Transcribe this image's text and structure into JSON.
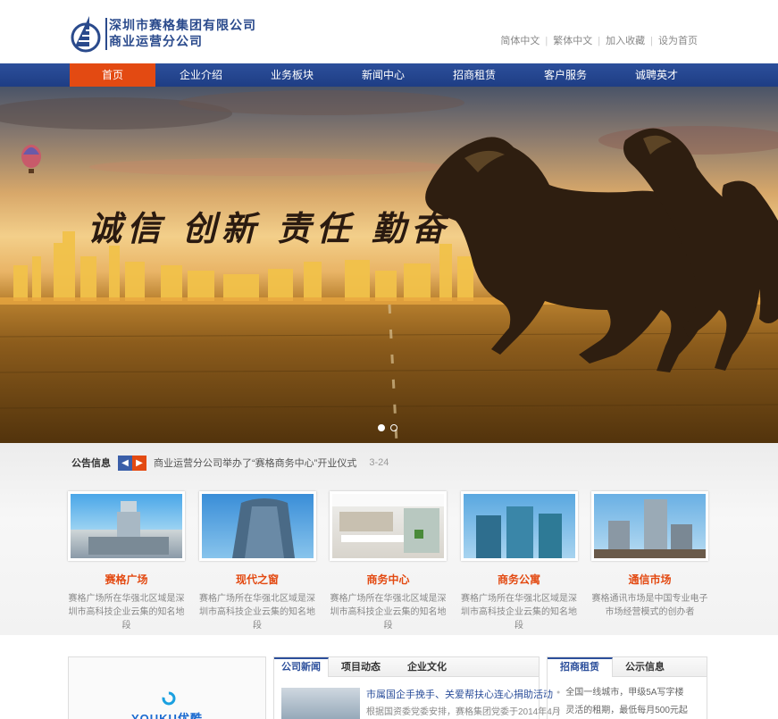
{
  "header": {
    "logo_line1": "深圳市赛格集团有限公司",
    "logo_line2": "商业运营分公司",
    "top_links": [
      "简体中文",
      "繁体中文",
      "加入收藏",
      "设为首页"
    ]
  },
  "nav": {
    "items": [
      "首页",
      "企业介绍",
      "业务板块",
      "新闻中心",
      "招商租赁",
      "客户服务",
      "诚聘英才"
    ],
    "active_index": 0
  },
  "banner": {
    "slogan": [
      "诚信",
      "创新",
      "责任",
      "勤奋"
    ],
    "slide_count": 2,
    "active_slide": 0
  },
  "notice": {
    "label": "公告信息",
    "text": "商业运营分公司举办了“赛格商务中心”开业仪式",
    "date": "3-24"
  },
  "cards": [
    {
      "title": "赛格广场",
      "desc": "赛格广场所在华强北区域是深圳市高科技企业云集的知名地段"
    },
    {
      "title": "现代之窗",
      "desc": "赛格广场所在华强北区域是深圳市高科技企业云集的知名地段"
    },
    {
      "title": "商务中心",
      "desc": "赛格广场所在华强北区域是深圳市高科技企业云集的知名地段"
    },
    {
      "title": "商务公寓",
      "desc": "赛格广场所在华强北区域是深圳市高科技企业云集的知名地段"
    },
    {
      "title": "通信市场",
      "desc": "赛格通讯市场是中国专业电子市场经营模式的创办者"
    }
  ],
  "video": {
    "brand": "YOUKU优酷"
  },
  "news": {
    "tabs": [
      "公司新闻",
      "项目动态",
      "企业文化"
    ],
    "active_tab": 0,
    "headline": "市属国企手挽手、关爱帮扶心连心捐助活动",
    "summary": "根据国资委党委安排，赛格集团党委于2014年4月"
  },
  "rent": {
    "tabs": [
      "招商租赁",
      "公示信息"
    ],
    "active_tab": 0,
    "items": [
      "全国一线城市，甲级5A写字楼",
      "灵活的租期，最低每月500元起"
    ]
  },
  "colors": {
    "brand_blue": "#2c4f9b",
    "accent_orange": "#e34a12"
  }
}
